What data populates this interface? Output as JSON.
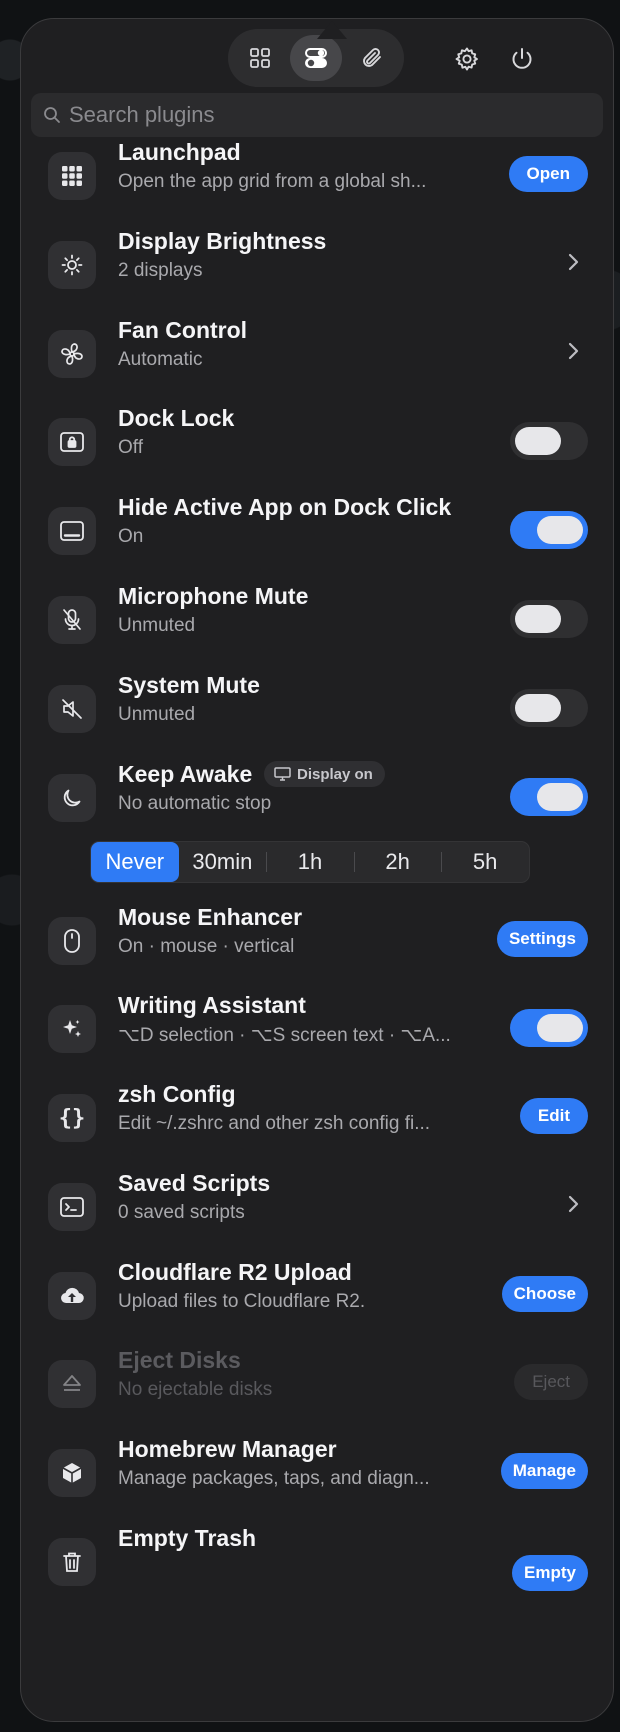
{
  "search": {
    "placeholder": "Search plugins"
  },
  "plugins": [
    {
      "title": "Launchpad",
      "subtitle": "Open the app grid from a global sh...",
      "icon": "grid-icon",
      "control": {
        "type": "button",
        "label": "Open"
      }
    },
    {
      "title": "Display Brightness",
      "subtitle": "2 displays",
      "icon": "sun-icon",
      "control": {
        "type": "chevron"
      }
    },
    {
      "title": "Fan Control",
      "subtitle": "Automatic",
      "icon": "fan-icon",
      "control": {
        "type": "chevron"
      }
    },
    {
      "title": "Dock Lock",
      "subtitle": "Off",
      "icon": "dock-lock-icon",
      "control": {
        "type": "toggle",
        "on": false
      }
    },
    {
      "title": "Hide Active App on Dock Click",
      "subtitle": "On",
      "icon": "dock-icon",
      "control": {
        "type": "toggle",
        "on": true
      }
    },
    {
      "title": "Microphone Mute",
      "subtitle": "Unmuted",
      "icon": "mic-slash-icon",
      "control": {
        "type": "toggle",
        "on": false
      }
    },
    {
      "title": "System Mute",
      "subtitle": "Unmuted",
      "icon": "speaker-slash-icon",
      "control": {
        "type": "toggle",
        "on": false
      }
    },
    {
      "title": "Keep Awake",
      "subtitle": "No automatic stop",
      "icon": "moon-icon",
      "badge": "Display on",
      "control": {
        "type": "toggle",
        "on": true
      }
    },
    {
      "title": "Mouse Enhancer",
      "subtitle": "On · mouse · vertical",
      "icon": "mouse-icon",
      "control": {
        "type": "button",
        "label": "Settings"
      }
    },
    {
      "title": "Writing Assistant",
      "subtitle": "⌥D selection · ⌥S screen text · ⌥A...",
      "icon": "sparkle-icon",
      "control": {
        "type": "toggle",
        "on": true
      }
    },
    {
      "title": "zsh Config",
      "subtitle": "Edit ~/.zshrc and other zsh config fi...",
      "icon": "braces-icon",
      "control": {
        "type": "button",
        "label": "Edit"
      }
    },
    {
      "title": "Saved Scripts",
      "subtitle": "0 saved scripts",
      "icon": "terminal-icon",
      "control": {
        "type": "chevron"
      }
    },
    {
      "title": "Cloudflare R2 Upload",
      "subtitle": "Upload files to Cloudflare R2.",
      "icon": "cloud-upload-icon",
      "control": {
        "type": "button",
        "label": "Choose"
      }
    },
    {
      "title": "Eject Disks",
      "subtitle": "No ejectable disks",
      "icon": "eject-icon",
      "disabled": true,
      "control": {
        "type": "button",
        "label": "Eject",
        "disabled": true
      }
    },
    {
      "title": "Homebrew Manager",
      "subtitle": "Manage packages, taps, and diagn...",
      "icon": "box-icon",
      "control": {
        "type": "button",
        "label": "Manage"
      }
    },
    {
      "title": "Empty Trash",
      "subtitle": "",
      "icon": "trash-icon",
      "control": {
        "type": "button",
        "label": "Empty"
      }
    }
  ],
  "keep_awake_durations": {
    "options": [
      "Never",
      "30min",
      "1h",
      "2h",
      "5h"
    ],
    "selected": "Never"
  },
  "colors": {
    "accent": "#2f7bf5",
    "panel": "#1f1f21",
    "row_icon_bg": "#303033"
  }
}
